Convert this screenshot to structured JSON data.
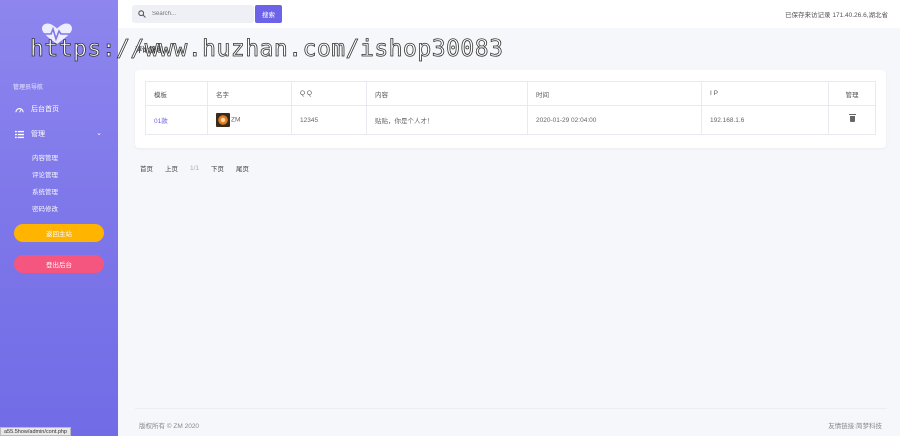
{
  "sidebar": {
    "section_label": "管理员导航",
    "home_label": "后台首页",
    "manage_label": "管理",
    "sub_items": [
      "内容管理",
      "评论管理",
      "系统管理",
      "密码修改"
    ],
    "main_button": "返回主站",
    "logout_button": "登出后台"
  },
  "header": {
    "search_placeholder": "Search...",
    "search_button": "搜索",
    "visitor_text": "已保存来访记录 171.40.26.6,湖北省"
  },
  "watermark": "https://www.huzhan.com/ishop30083",
  "page_title": "评论管理",
  "table": {
    "headers": [
      "模板",
      "名字",
      "Q Q",
      "内容",
      "时间",
      "I P",
      "管理"
    ],
    "rows": [
      {
        "module": "01款",
        "name": "ZM",
        "qq": "12345",
        "content": "贴贴，你是个人才！",
        "time": "2020-01-29 02:04:00",
        "ip": "192.168.1.6"
      }
    ]
  },
  "pager": [
    "首页",
    "上页",
    "1/1",
    "下页",
    "尾页"
  ],
  "footer": {
    "copyright": "版权所有 © ZM 2020",
    "link_text": "友情链接:简梦科技"
  },
  "status_url": "a55.5how/admin/cont.php",
  "colors": {
    "sidebar_top": "#8e86ee",
    "sidebar_bottom": "#716ce6",
    "accent": "#6c63e8",
    "yellow": "#ffb400",
    "pink": "#f5567f"
  }
}
